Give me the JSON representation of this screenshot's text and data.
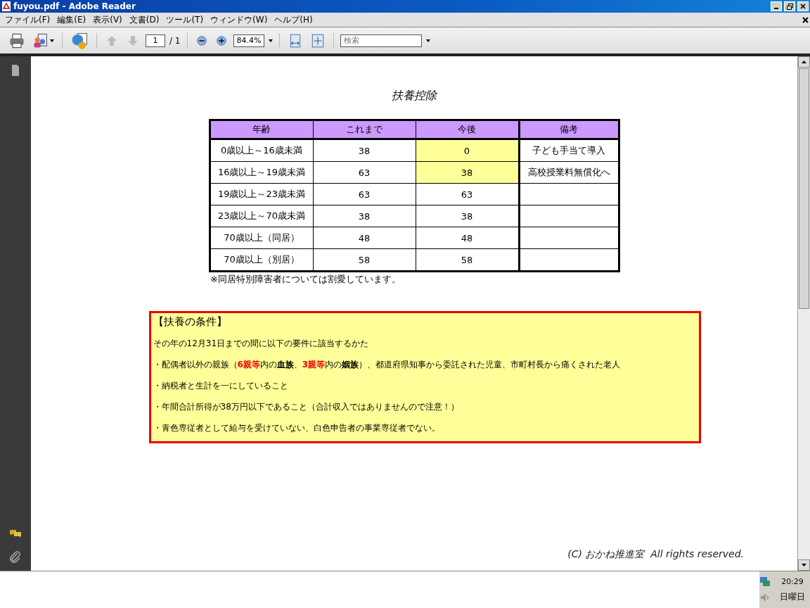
{
  "window": {
    "title": "fuyou.pdf - Adobe Reader"
  },
  "menu": [
    "ファイル(F)",
    "編集(E)",
    "表示(V)",
    "文書(D)",
    "ツール(T)",
    "ウィンドウ(W)",
    "ヘルプ(H)"
  ],
  "toolbar": {
    "page": "1",
    "page_total": "/ 1",
    "zoom": "84.4%",
    "search": {
      "placeholder": "検索"
    }
  },
  "document": {
    "title": "扶養控除",
    "table": {
      "columns": [
        "年齢",
        "これまで",
        "今後",
        "備考"
      ],
      "rows": [
        {
          "cells": [
            "0歳以上～16歳未満",
            "38",
            "0",
            "子ども手当て導入"
          ],
          "highlighted": true
        },
        {
          "cells": [
            "16歳以上～19歳未満",
            "63",
            "38",
            "高校授業料無償化へ"
          ],
          "highlighted": true
        },
        {
          "cells": [
            "19歳以上～23歳未満",
            "63",
            "63"
          ],
          "highlighted": false
        },
        {
          "cells": [
            "23歳以上～70歳未満",
            "38",
            "38"
          ],
          "highlighted": false
        },
        {
          "cells": [
            "70歳以上（同居）",
            "48",
            "48"
          ],
          "highlighted": false
        },
        {
          "cells": [
            "70歳以上（別居）",
            "58",
            "58"
          ],
          "highlighted": false
        }
      ]
    },
    "note": "※同居特別障害者については割愛しています。",
    "conditions": {
      "heading": "【扶養の条件】",
      "lines": [
        [
          {
            "kind": "plain",
            "text": "その年の12月31日までの間に以下の要件に該当するかた"
          }
        ],
        [
          {
            "kind": "plain",
            "text": "・配偶者以外の親族（"
          },
          {
            "kind": "red",
            "text": "6親等"
          },
          {
            "kind": "plain",
            "text": "内の"
          },
          {
            "kind": "bold",
            "text": "血族"
          },
          {
            "kind": "plain",
            "text": "、"
          },
          {
            "kind": "red",
            "text": "3親等"
          },
          {
            "kind": "plain",
            "text": "内の"
          },
          {
            "kind": "bold",
            "text": "姻族"
          },
          {
            "kind": "plain",
            "text": "）、都道府県知事から委託された児童、市町村長から痛くされた老人"
          }
        ],
        [
          {
            "kind": "plain",
            "text": "・納税者と生計を一にしていること"
          }
        ],
        [
          {
            "kind": "plain",
            "text": "・年間合計所得が38万円以下であること（合計収入ではありませんので注意！）"
          }
        ],
        [
          {
            "kind": "plain",
            "text": "・青色専従者として給与を受けていない、白色申告者の事業専従者でない。"
          }
        ]
      ]
    },
    "copyright": "(C) おかね推進室  All rights reserved."
  },
  "tray": {
    "time": "20:29",
    "day": "日曜日"
  }
}
